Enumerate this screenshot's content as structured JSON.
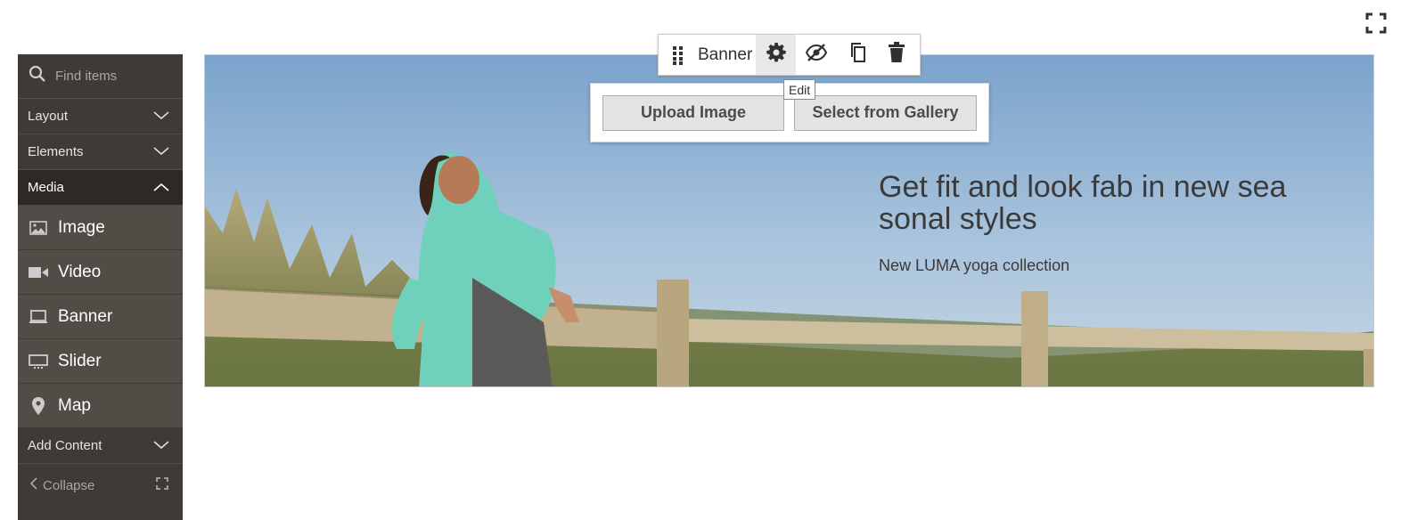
{
  "sidebar": {
    "search": {
      "placeholder": "Find items"
    },
    "sections": [
      {
        "label": "Layout",
        "expanded": false
      },
      {
        "label": "Elements",
        "expanded": false
      },
      {
        "label": "Media",
        "expanded": true
      }
    ],
    "media_items": [
      {
        "label": "Image",
        "icon": "image-icon"
      },
      {
        "label": "Video",
        "icon": "video-icon"
      },
      {
        "label": "Banner",
        "icon": "banner-icon"
      },
      {
        "label": "Slider",
        "icon": "slider-icon"
      },
      {
        "label": "Map",
        "icon": "map-pin-icon"
      }
    ],
    "add_content": {
      "label": "Add Content",
      "expanded": false
    },
    "collapse_label": "Collapse"
  },
  "toolbar": {
    "label": "Banner",
    "tooltip": "Edit",
    "actions": [
      "drag-handle-icon",
      "gear-icon",
      "eye-slash-icon",
      "copy-icon",
      "trash-icon"
    ]
  },
  "uploader": {
    "upload_label": "Upload Image",
    "gallery_label": "Select from Gallery"
  },
  "banner": {
    "title": "Get fit and look fab in new seasonal styles",
    "subtitle": "New LUMA yoga collection"
  },
  "colors": {
    "sidebar_bg": "#3d3a37",
    "sidebar_item_bg": "#524c47",
    "button_bg": "#e3e3e3",
    "button_text": "#514943"
  }
}
